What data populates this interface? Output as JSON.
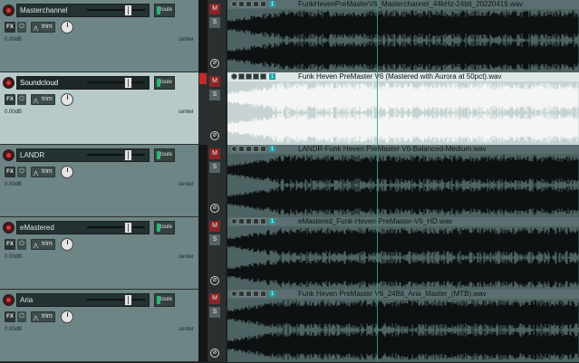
{
  "tracks": [
    {
      "name": "Masterchannel",
      "route_label": "Route",
      "fx_label": "FX",
      "trim_label": "trim",
      "volume": "0.00dB",
      "pan": "center",
      "mute": "M",
      "solo": "S",
      "phase": "ø",
      "file": "FunkHevenPreMasterV6_Masterchannel_44kHz-24bit_20220419.wav",
      "selected": false
    },
    {
      "name": "Soundcloud",
      "route_label": "Route",
      "fx_label": "FX",
      "trim_label": "trim",
      "volume": "0.00dB",
      "pan": "center",
      "mute": "M",
      "solo": "S",
      "phase": "ø",
      "file": "Funk Heven PreMaster V6 (Mastered with Aurora at 50pct).wav",
      "selected": true
    },
    {
      "name": "LANDR",
      "route_label": "Route",
      "fx_label": "FX",
      "trim_label": "trim",
      "volume": "0.00dB",
      "pan": "center",
      "mute": "M",
      "solo": "S",
      "phase": "ø",
      "file": "LANDR-Funk Heven PreMaster V6-Balanced-Medium.wav",
      "selected": false
    },
    {
      "name": "eMastered",
      "route_label": "Route",
      "fx_label": "FX",
      "trim_label": "trim",
      "volume": "0.00dB",
      "pan": "center",
      "mute": "M",
      "solo": "S",
      "phase": "ø",
      "file": "eMastered_Funk-Heven-PreMaster-V6_HD.wav",
      "selected": false
    },
    {
      "name": "Aria",
      "route_label": "Route",
      "fx_label": "FX",
      "trim_label": "trim",
      "volume": "0.00dB",
      "pan": "center",
      "mute": "M",
      "solo": "S",
      "phase": "ø",
      "file": "Funk Heven PreMaster V6_24Bit_Aria_Master_(MTB).wav",
      "selected": false
    }
  ],
  "item_number": "1",
  "colors": {
    "selected_bg": "#b8c9c9",
    "tcp_bg": "#6e8586",
    "lane_bg": "#4d6262",
    "cursor": "#2ea17e",
    "record": "#d23a36"
  },
  "icons": {
    "record": "record-arm-icon",
    "fx_power": "power-icon",
    "trim": "trim-envelope-icon",
    "phase": "phase-invert-icon"
  }
}
